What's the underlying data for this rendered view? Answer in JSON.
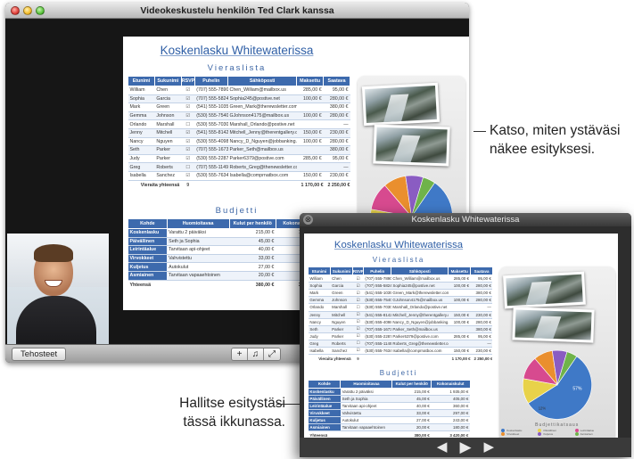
{
  "main_window": {
    "title": "Videokeskustelu henkilön Ted Clark kanssa",
    "effects_button": "Tehosteet",
    "controls": [
      "+",
      "mute-icon",
      "fullscreen-icon"
    ]
  },
  "slide": {
    "title": "Koskenlasku Whitewaterissa",
    "guest_section": "Vieraslista",
    "guest_headers": [
      "Etunimi",
      "Sukunimi",
      "RSVP",
      "Puhelin",
      "Sähköposti",
      "Maksettu",
      "Saatava"
    ],
    "guests": [
      [
        "William",
        "Chen",
        "☑",
        "(707) 555-7890",
        "Chen_William@mailbox.us",
        "285,00 €",
        "95,00 €"
      ],
      [
        "Sophia",
        "Garcia",
        "☑",
        "(707) 555-5824",
        "Sophia245@postive.net",
        "100,00 €",
        "280,00 €"
      ],
      [
        "Mark",
        "Green",
        "☑",
        "(541) 555-1035",
        "Green_Mark@therewsletter.com",
        "",
        "380,00 €"
      ],
      [
        "Gemma",
        "Johnson",
        "☑",
        "(530) 555-7540",
        "GJohnson4175@mailbox.us",
        "100,00 €",
        "280,00 €"
      ],
      [
        "Orlando",
        "Marshall",
        "☐",
        "(530) 555-7030",
        "Marshall_Orlando@postive.net",
        "",
        "—"
      ],
      [
        "Jenny",
        "Mitchell",
        "☑",
        "(541) 555-8142",
        "Mitchell_Jenny@therentgallery.com",
        "150,00 €",
        "230,00 €"
      ],
      [
        "Nancy",
        "Nguyen",
        "☑",
        "(530) 555-4098",
        "Nancy_D_Nguyen@jobbanking.com",
        "100,00 €",
        "280,00 €"
      ],
      [
        "Seth",
        "Parker",
        "☑",
        "(707) 555-1673",
        "Parker_Seth@mailbox.us",
        "",
        "380,00 €"
      ],
      [
        "Judy",
        "Parker",
        "☑",
        "(530) 555-2287",
        "Parker6379@postive.com",
        "285,00 €",
        "95,00 €"
      ],
      [
        "Greg",
        "Roberts",
        "☐",
        "(707) 555-1149",
        "Roberts_Greg@thenewsletter.com",
        "",
        "—"
      ],
      [
        "Isabella",
        "Sanchez",
        "☑",
        "(530) 555-7634",
        "Isabella@comprnatbox.com",
        "150,00 €",
        "230,00 €"
      ]
    ],
    "guest_total_label": "Vieraita yhteensä",
    "guest_total_count": "9",
    "guest_total_paid": "1 170,00 €",
    "guest_total_due": "2 250,00 €",
    "budget_section": "Budjetti",
    "budget_headers": [
      "Kohde",
      "Huomioitavaa",
      "Kulut per henkilö",
      "Kokonaiskulut"
    ],
    "budget_rows": [
      [
        "Koskenlasku",
        "Varattu 2 päiväksi",
        "215,00 €",
        "1 935,00 €"
      ],
      [
        "Päivällinen",
        "Seth ja Sophia",
        "45,00 €",
        "405,00 €"
      ],
      [
        "Leirintäalue",
        "Tarvitaan api-ohjeet",
        "40,00 €",
        "360,00 €"
      ],
      [
        "Virvokkeet",
        "Vahvistettu",
        "33,00 €",
        "297,00 €"
      ],
      [
        "Kuljetus",
        "Autokulut",
        "27,00 €",
        "243,00 €"
      ],
      [
        "Asmiainen",
        "Tarvitaan vapaaehtoinen",
        "20,00 €",
        "180,00 €"
      ]
    ],
    "budget_total_label": "Yhteensä",
    "budget_total_per_person": "380,00 €",
    "budget_total": "3 420,00 €",
    "pie_title": "Budjettikatsaus",
    "pie_center_label": "57%",
    "pie_label_a": "12%",
    "pie_legend": [
      "Koskenlasku",
      "Päivällinen",
      "Leirintäalue",
      "Virvokkeet",
      "Kuljetus",
      "Asmiainen"
    ]
  },
  "chart_data": {
    "type": "pie",
    "categories": [
      "Koskenlasku",
      "Päivällinen",
      "Leirintäalue",
      "Virvokkeet",
      "Kuljetus",
      "Asmiainen"
    ],
    "values": [
      57,
      12,
      11,
      9,
      7,
      5
    ],
    "title": "Budjettikatsaus",
    "colors": [
      "#3f79c7",
      "#e8d24a",
      "#d74a8f",
      "#ea8f2e",
      "#8a5cc2",
      "#6fb34a"
    ]
  },
  "front_window": {
    "title": "Koskenlasku Whitewaterissa",
    "close_icon": "⊗",
    "nav": [
      "◀",
      "▶",
      "▶"
    ]
  },
  "callouts": {
    "top": "Katso, miten ystäväsi\nnäkee esityksesi.",
    "bottom": "Hallitse esitystäsi\ntässä ikkunassa."
  }
}
